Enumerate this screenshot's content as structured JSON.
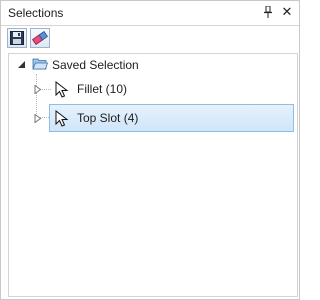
{
  "panel": {
    "title": "Selections"
  },
  "toolbar": {
    "buttons": [
      {
        "icon": "save-icon"
      },
      {
        "icon": "eraser-icon"
      }
    ]
  },
  "tree": {
    "root": {
      "label": "Saved Selection",
      "icon": "folder-open-icon",
      "expanded": true,
      "children": [
        {
          "label": "Fillet (10)",
          "icon": "cursor-icon",
          "selected": false
        },
        {
          "label": "Top Slot (4)",
          "icon": "cursor-icon",
          "selected": true
        }
      ]
    }
  },
  "colors": {
    "selection_bg": "#cfe5f9",
    "selection_border": "#8ebde8"
  }
}
